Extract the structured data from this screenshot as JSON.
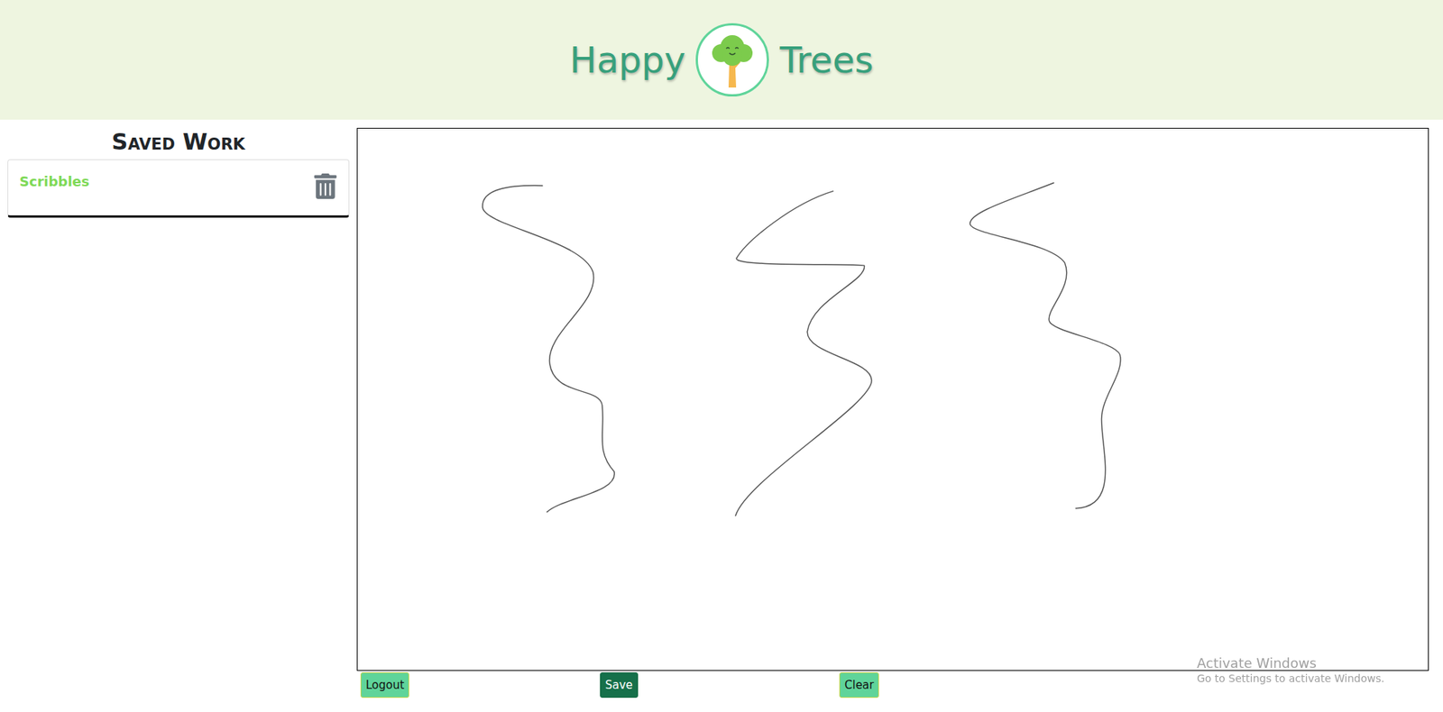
{
  "header": {
    "title_left": "Happy",
    "title_right": "Trees"
  },
  "sidebar": {
    "title": "Saved Work",
    "items": [
      {
        "label": "Scribbles"
      }
    ]
  },
  "buttons": [
    {
      "label": "Logout",
      "kind": "secondary"
    },
    {
      "label": "Save",
      "kind": "primary"
    },
    {
      "label": "Clear",
      "kind": "secondary"
    }
  ],
  "watermark": {
    "title": "Activate Windows",
    "subtitle": "Go to Settings to activate Windows."
  }
}
